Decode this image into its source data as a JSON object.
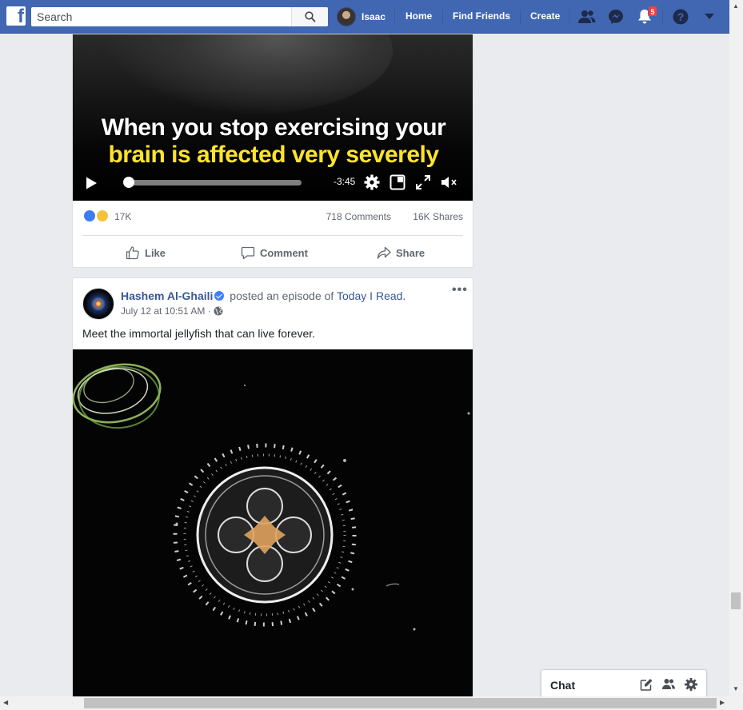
{
  "topbar": {
    "search_placeholder": "Search",
    "profile_name": "Isaac",
    "nav": [
      "Home",
      "Find Friends",
      "Create"
    ],
    "notification_count": "5",
    "brand_color": "#4267b2"
  },
  "post1": {
    "caption_line1": "When you stop exercising your",
    "caption_line2": "brain is affected very severely",
    "time_remaining": "-3:45",
    "progress": 0.02,
    "reactions_count": "17K",
    "comments": "718 Comments",
    "shares": "16K Shares",
    "actions": [
      "Like",
      "Comment",
      "Share"
    ]
  },
  "post2": {
    "author": "Hashem Al-Ghaili",
    "verb": "posted an episode of",
    "show": "Today I Read.",
    "timestamp": "July 12 at 10:51 AM",
    "separator": "·",
    "text": "Meet the immortal jellyfish that can live forever."
  },
  "chat": {
    "label": "Chat"
  },
  "icons": [
    "search-icon",
    "friend-requests-icon",
    "messenger-icon",
    "notifications-icon",
    "help-icon",
    "dropdown-icon",
    "play-icon",
    "settings-icon",
    "pip-icon",
    "fullscreen-icon",
    "mute-icon",
    "like-icon",
    "comment-icon",
    "share-icon",
    "globe-icon",
    "new-message-icon",
    "new-group-icon",
    "gear-icon"
  ]
}
